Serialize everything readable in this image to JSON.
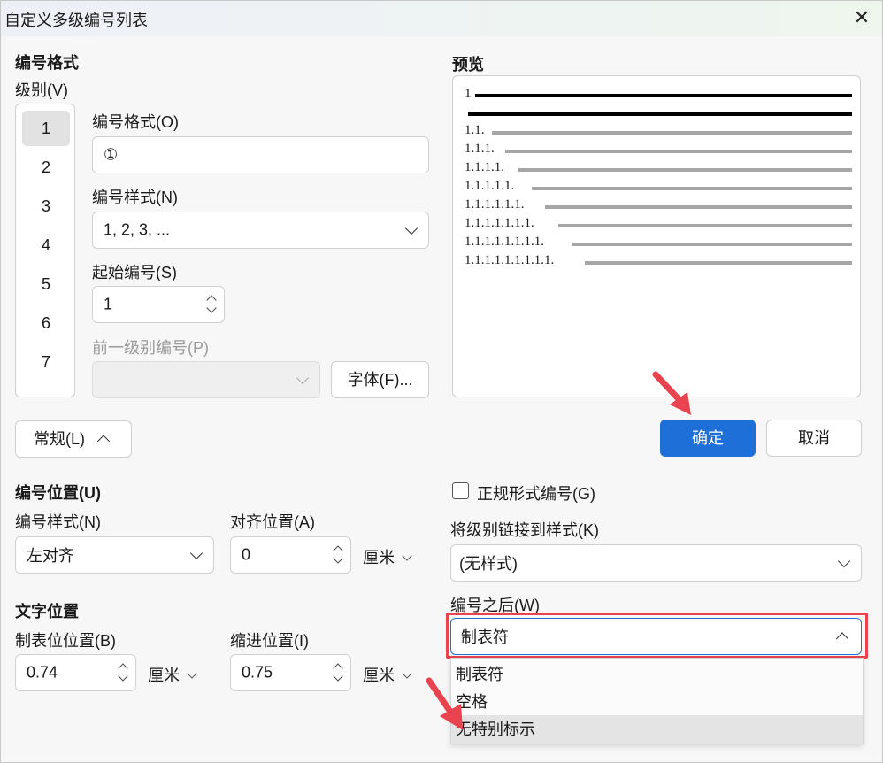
{
  "window": {
    "title": "自定义多级编号列表",
    "close_icon": "close-icon"
  },
  "numbering_format": {
    "heading": "编号格式",
    "level_label": "级别(V)",
    "levels": [
      "1",
      "2",
      "3",
      "4",
      "5",
      "6",
      "7"
    ],
    "selected_level": "1",
    "format_label": "编号格式(O)",
    "format_value": "①",
    "style_label": "编号样式(N)",
    "style_value": "1, 2, 3, ...",
    "start_label": "起始编号(S)",
    "start_value": "1",
    "prev_level_label": "前一级别编号(P)",
    "prev_level_value": "",
    "font_button": "字体(F)..."
  },
  "preview": {
    "heading": "预览",
    "rows": [
      "1",
      "1.1.",
      "1.1.1.",
      "1.1.1.1.",
      "1.1.1.1.1.",
      "1.1.1.1.1.1.",
      "1.1.1.1.1.1.1.",
      "1.1.1.1.1.1.1.1.",
      "1.1.1.1.1.1.1.1.1."
    ]
  },
  "general_toggle": "常规(L)",
  "buttons": {
    "ok": "确定",
    "cancel": "取消"
  },
  "number_position": {
    "heading": "编号位置(U)",
    "style_label": "编号样式(N)",
    "style_value": "左对齐",
    "align_label": "对齐位置(A)",
    "align_value": "0",
    "align_unit": "厘米"
  },
  "text_position": {
    "heading": "文字位置",
    "tab_label": "制表位位置(B)",
    "tab_value": "0.74",
    "tab_unit": "厘米",
    "indent_label": "缩进位置(I)",
    "indent_value": "0.75",
    "indent_unit": "厘米"
  },
  "right_options": {
    "legal_checkbox_label": "正规形式编号(G)",
    "legal_checked": false,
    "link_label": "将级别链接到样式(K)",
    "link_value": "(无样式)",
    "after_label": "编号之后(W)",
    "after_value": "制表符",
    "after_options": [
      "制表符",
      "空格",
      "无特别标示"
    ],
    "after_highlighted": "无特别标示"
  },
  "colors": {
    "primary": "#1f6fd9",
    "annotation_red": "#e8434f"
  }
}
